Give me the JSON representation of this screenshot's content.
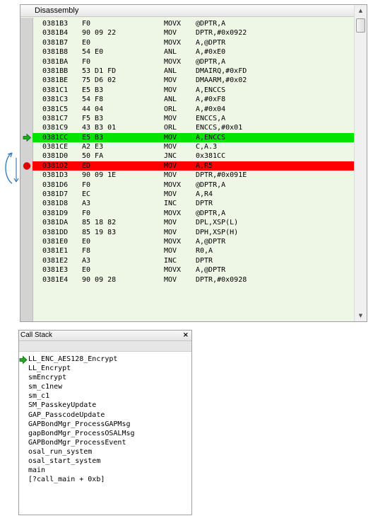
{
  "disassembly": {
    "title": "Disassembly",
    "scroll_up": "▲",
    "scroll_down": "▼",
    "rows": [
      {
        "addr": "0381B3",
        "bytes": "F0",
        "mnemonic": "MOVX",
        "operands": "@DPTR,A"
      },
      {
        "addr": "0381B4",
        "bytes": "90 09 22",
        "mnemonic": "MOV",
        "operands": "DPTR,#0x0922"
      },
      {
        "addr": "0381B7",
        "bytes": "E0",
        "mnemonic": "MOVX",
        "operands": "A,@DPTR"
      },
      {
        "addr": "0381B8",
        "bytes": "54 E0",
        "mnemonic": "ANL",
        "operands": "A,#0xE0"
      },
      {
        "addr": "0381BA",
        "bytes": "F0",
        "mnemonic": "MOVX",
        "operands": "@DPTR,A"
      },
      {
        "addr": "0381BB",
        "bytes": "53 D1 FD",
        "mnemonic": "ANL",
        "operands": "DMAIRQ,#0xFD"
      },
      {
        "addr": "0381BE",
        "bytes": "75 D6 02",
        "mnemonic": "MOV",
        "operands": "DMAARM,#0x02"
      },
      {
        "addr": "0381C1",
        "bytes": "E5 B3",
        "mnemonic": "MOV",
        "operands": "A,ENCCS"
      },
      {
        "addr": "0381C3",
        "bytes": "54 F8",
        "mnemonic": "ANL",
        "operands": "A,#0xF8"
      },
      {
        "addr": "0381C5",
        "bytes": "44 04",
        "mnemonic": "ORL",
        "operands": "A,#0x04"
      },
      {
        "addr": "0381C7",
        "bytes": "F5 B3",
        "mnemonic": "MOV",
        "operands": "ENCCS,A"
      },
      {
        "addr": "0381C9",
        "bytes": "43 B3 01",
        "mnemonic": "ORL",
        "operands": "ENCCS,#0x01"
      },
      {
        "addr": "0381CC",
        "bytes": "E5 B3",
        "mnemonic": "MOV",
        "operands": "A,ENCCS",
        "state": "current"
      },
      {
        "addr": "0381CE",
        "bytes": "A2 E3",
        "mnemonic": "MOV",
        "operands": "C,A.3"
      },
      {
        "addr": "0381D0",
        "bytes": "50 FA",
        "mnemonic": "JNC",
        "operands": "0x381CC"
      },
      {
        "addr": "0381D2",
        "bytes": "ED",
        "mnemonic": "MOV",
        "operands": "A,R5",
        "state": "breakpoint"
      },
      {
        "addr": "0381D3",
        "bytes": "90 09 1E",
        "mnemonic": "MOV",
        "operands": "DPTR,#0x091E"
      },
      {
        "addr": "0381D6",
        "bytes": "F0",
        "mnemonic": "MOVX",
        "operands": "@DPTR,A"
      },
      {
        "addr": "0381D7",
        "bytes": "EC",
        "mnemonic": "MOV",
        "operands": "A,R4"
      },
      {
        "addr": "0381D8",
        "bytes": "A3",
        "mnemonic": "INC",
        "operands": "DPTR"
      },
      {
        "addr": "0381D9",
        "bytes": "F0",
        "mnemonic": "MOVX",
        "operands": "@DPTR,A"
      },
      {
        "addr": "0381DA",
        "bytes": "85 18 82",
        "mnemonic": "MOV",
        "operands": "DPL,XSP(L)"
      },
      {
        "addr": "0381DD",
        "bytes": "85 19 83",
        "mnemonic": "MOV",
        "operands": "DPH,XSP(H)"
      },
      {
        "addr": "0381E0",
        "bytes": "E0",
        "mnemonic": "MOVX",
        "operands": "A,@DPTR"
      },
      {
        "addr": "0381E1",
        "bytes": "F8",
        "mnemonic": "MOV",
        "operands": "R0,A"
      },
      {
        "addr": "0381E2",
        "bytes": "A3",
        "mnemonic": "INC",
        "operands": "DPTR"
      },
      {
        "addr": "0381E3",
        "bytes": "E0",
        "mnemonic": "MOVX",
        "operands": "A,@DPTR"
      },
      {
        "addr": "0381E4",
        "bytes": "90 09 28",
        "mnemonic": "MOV",
        "operands": "DPTR,#0x0928"
      }
    ]
  },
  "call_stack": {
    "title": "Call Stack",
    "close_label": "×",
    "frames": [
      "LL_ENC_AES128_Encrypt",
      "LL_Encrypt",
      "smEncrypt",
      "sm_c1new",
      "sm_c1",
      "SM_PasskeyUpdate",
      "GAP_PasscodeUpdate",
      "GAPBondMgr_ProcessGAPMsg",
      "gapBondMgr_ProcessOSALMsg",
      "GAPBondMgr_ProcessEvent",
      "osal_run_system",
      "osal_start_system",
      "main",
      "[?call_main + 0xb]"
    ]
  },
  "colors": {
    "current_line": "#00e400",
    "breakpoint_line": "#ff0000",
    "disasm_background": "#eef6e6",
    "arrow_icon": "#22aa22",
    "step_arrow": "#3a7ebf"
  },
  "icons": {
    "current_pointer": "green-arrow-icon",
    "breakpoint": "red-circle-icon",
    "step_back": "curved-arrow-icon"
  }
}
